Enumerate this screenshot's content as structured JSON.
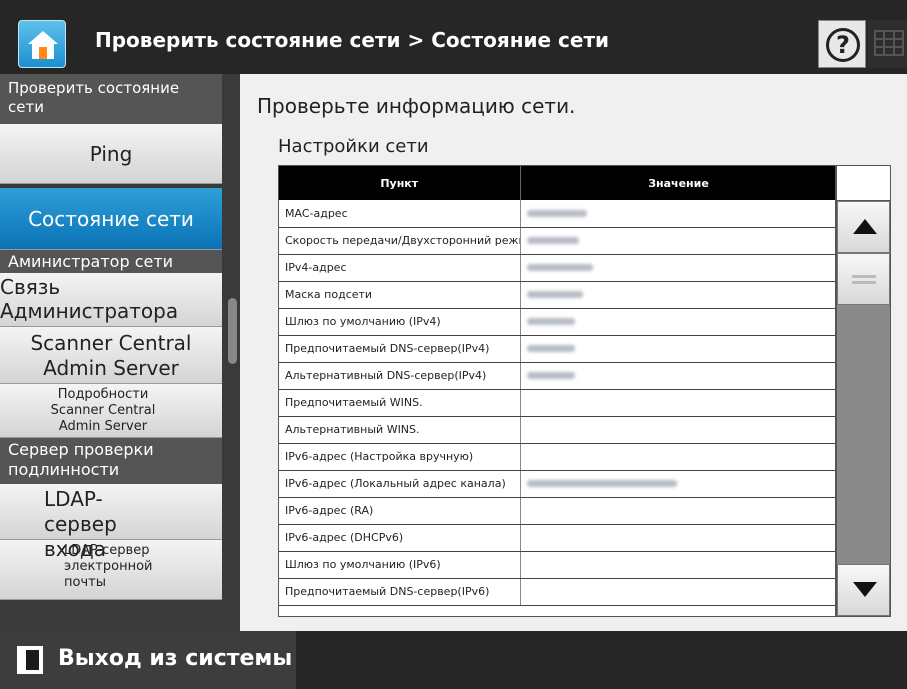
{
  "header": {
    "title": "Проверить состояние сети > Состояние сети",
    "help_symbol": "?",
    "icons": [
      "home-icon",
      "help-icon",
      "keyboard-icon"
    ]
  },
  "sidebar": {
    "section_check": "Проверить состояние сети",
    "ping": "Ping",
    "net_status": "Состояние сети",
    "section_admin": "Аминистратор сети",
    "admin_comm": "Связь Администратора",
    "scanner_central": "Scanner Central Admin Server",
    "scanner_central_details": "Подробности Scanner Central Admin Server",
    "section_auth": "Сервер проверки подлинности",
    "ldap_login": "LDAP-сервер входа",
    "ldap_email": "LDAP-сервер электронной почты"
  },
  "content": {
    "heading": "Проверьте информацию сети.",
    "subheading": "Настройки сети",
    "table": {
      "col_item": "Пункт",
      "col_value": "Значение",
      "rows": [
        {
          "item": "MAC-адрес",
          "value_hidden": true
        },
        {
          "item": "Скорость передачи/Двухсторонний режим",
          "value_hidden": true
        },
        {
          "item": "IPv4-адрес",
          "value_hidden": true
        },
        {
          "item": "Маска подсети",
          "value_hidden": true
        },
        {
          "item": "Шлюз по умолчанию (IPv4)",
          "value_hidden": true
        },
        {
          "item": "Предпочитаемый DNS-сервер(IPv4)",
          "value_hidden": true
        },
        {
          "item": "Альтернативный DNS-сервер(IPv4)",
          "value_hidden": true
        },
        {
          "item": "Предпочитаемый WINS.",
          "value_hidden": false
        },
        {
          "item": "Альтернативный WINS.",
          "value_hidden": false
        },
        {
          "item": "IPv6-адрес (Настройка вручную)",
          "value_hidden": false
        },
        {
          "item": "IPv6-адрес (Локальный адрес канала)",
          "value_hidden": true
        },
        {
          "item": "IPv6-адрес (RA)",
          "value_hidden": false
        },
        {
          "item": "IPv6-адрес (DHCPv6)",
          "value_hidden": false
        },
        {
          "item": "Шлюз по умолчанию (IPv6)",
          "value_hidden": false
        },
        {
          "item": "Предпочитаемый DNS-сервер(IPv6)",
          "value_hidden": false
        }
      ]
    }
  },
  "footer": {
    "logout": "Выход из системы"
  },
  "colors": {
    "accent": "#0a72b6",
    "bar": "#262626",
    "table_header": "#000000"
  }
}
